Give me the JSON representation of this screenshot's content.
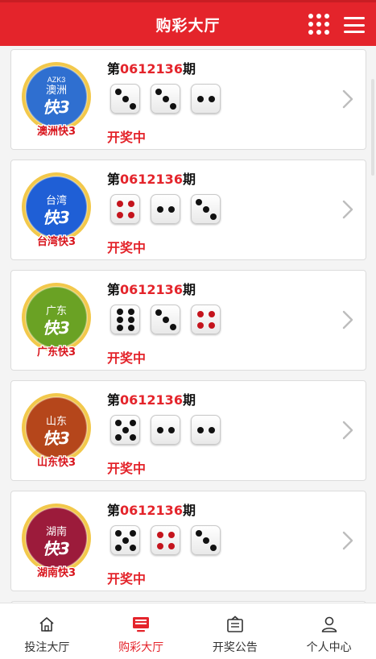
{
  "header": {
    "title": "购彩大厅",
    "grid_icon": "apps-grid-icon",
    "menu_icon": "hamburger-menu-icon"
  },
  "games": [
    {
      "logo_top": "AZK3",
      "logo_region": "澳洲",
      "logo_mark": "快3",
      "logo_caption": "澳洲快3",
      "logo_color": "#2f6fd0",
      "period_prefix": "第",
      "period_number": "0612136",
      "period_suffix": "期",
      "dice": [
        3,
        3,
        2
      ],
      "dice_red": [
        false,
        false,
        false
      ],
      "status": "开奖中"
    },
    {
      "logo_top": "",
      "logo_region": "台湾",
      "logo_mark": "快3",
      "logo_caption": "台湾快3",
      "logo_color": "#1f5fd6",
      "period_prefix": "第",
      "period_number": "0612136",
      "period_suffix": "期",
      "dice": [
        4,
        2,
        3
      ],
      "dice_red": [
        true,
        false,
        false
      ],
      "status": "开奖中"
    },
    {
      "logo_top": "",
      "logo_region": "广东",
      "logo_mark": "快3",
      "logo_caption": "广东快3",
      "logo_color": "#6aa224",
      "period_prefix": "第",
      "period_number": "0612136",
      "period_suffix": "期",
      "dice": [
        6,
        3,
        4
      ],
      "dice_red": [
        false,
        false,
        true
      ],
      "status": "开奖中"
    },
    {
      "logo_top": "",
      "logo_region": "山东",
      "logo_mark": "快3",
      "logo_caption": "山东快3",
      "logo_color": "#b5461b",
      "period_prefix": "第",
      "period_number": "0612136",
      "period_suffix": "期",
      "dice": [
        5,
        2,
        2
      ],
      "dice_red": [
        false,
        false,
        false
      ],
      "status": "开奖中"
    },
    {
      "logo_top": "",
      "logo_region": "湖南",
      "logo_mark": "快3",
      "logo_caption": "湖南快3",
      "logo_color": "#9c1b3b",
      "period_prefix": "第",
      "period_number": "0612136",
      "period_suffix": "期",
      "dice": [
        5,
        4,
        3
      ],
      "dice_red": [
        false,
        true,
        false
      ],
      "status": "开奖中"
    }
  ],
  "tabbar": {
    "items": [
      {
        "label": "投注大厅",
        "icon": "home-icon",
        "active": false
      },
      {
        "label": "购彩大厅",
        "icon": "monitor-icon",
        "active": true
      },
      {
        "label": "开奖公告",
        "icon": "announcement-icon",
        "active": false
      },
      {
        "label": "个人中心",
        "icon": "user-icon",
        "active": false
      }
    ]
  },
  "colors": {
    "brand": "#e4242b",
    "text": "#111111",
    "muted": "#333333"
  }
}
